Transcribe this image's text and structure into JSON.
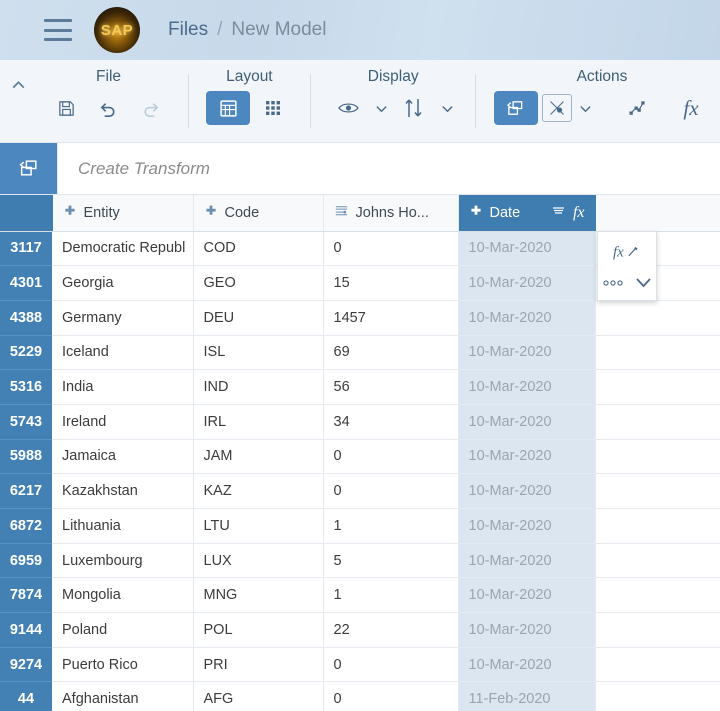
{
  "shellbar": {
    "menu_icon": "hamburger-menu-icon",
    "logo_text": "SAP",
    "breadcrumb": {
      "root": "Files",
      "separator": "/",
      "current": "New Model"
    }
  },
  "toolbar": {
    "collapse_icon": "chevron-up-icon",
    "groups": [
      {
        "title": "File",
        "items": [
          {
            "name": "save-button",
            "icon": "save-floppy-icon",
            "state": "enabled"
          },
          {
            "name": "undo-button",
            "icon": "undo-arrow-icon",
            "state": "enabled"
          },
          {
            "name": "redo-button",
            "icon": "redo-arrow-icon",
            "state": "disabled"
          }
        ]
      },
      {
        "title": "Layout",
        "items": [
          {
            "name": "grid-view-button",
            "icon": "table-grid-icon",
            "state": "selected"
          },
          {
            "name": "tile-view-button",
            "icon": "tiles-icon",
            "state": "enabled"
          }
        ]
      },
      {
        "title": "Display",
        "items": [
          {
            "name": "visibility-button",
            "icon": "eye-icon",
            "state": "enabled",
            "has_chevron": true
          },
          {
            "name": "sort-button",
            "icon": "sort-updown-arrows-icon",
            "state": "enabled",
            "has_chevron": true
          }
        ]
      },
      {
        "title": "Actions",
        "items": [
          {
            "name": "create-transform-button",
            "icon": "transform-icon",
            "state": "selected"
          },
          {
            "name": "filter-map-button",
            "icon": "geo-enrich-icon",
            "state": "outlined",
            "has_chevron": true
          },
          {
            "name": "smart-transform-button",
            "icon": "data-points-icon",
            "state": "enabled"
          },
          {
            "name": "formula-button",
            "icon": "fx-icon",
            "state": "enabled"
          }
        ]
      }
    ]
  },
  "formula_bar": {
    "icon": "transform-icon",
    "placeholder": "Create Transform",
    "value": ""
  },
  "grid": {
    "columns": [
      {
        "key": "rownum",
        "label": "",
        "icon": "",
        "selected": false
      },
      {
        "key": "entity",
        "label": "Entity",
        "icon": "dimension-icon",
        "selected": false
      },
      {
        "key": "code",
        "label": "Code",
        "icon": "dimension-icon",
        "selected": false
      },
      {
        "key": "measure",
        "label": "Johns Ho...",
        "icon": "measure-icon",
        "selected": false
      },
      {
        "key": "date",
        "label": "Date",
        "icon": "dimension-icon",
        "selected": true,
        "header_icons": [
          "menu-lines-icon",
          "fx-icon"
        ]
      },
      {
        "key": "blank",
        "label": "",
        "icon": "",
        "selected": false
      }
    ],
    "rows": [
      {
        "num": "3117",
        "entity": "Democratic Republ",
        "code": "COD",
        "measure": "0",
        "date": "10-Mar-2020"
      },
      {
        "num": "4301",
        "entity": "Georgia",
        "code": "GEO",
        "measure": "15",
        "date": "10-Mar-2020"
      },
      {
        "num": "4388",
        "entity": "Germany",
        "code": "DEU",
        "measure": "1457",
        "date": "10-Mar-2020"
      },
      {
        "num": "5229",
        "entity": "Iceland",
        "code": "ISL",
        "measure": "69",
        "date": "10-Mar-2020"
      },
      {
        "num": "5316",
        "entity": "India",
        "code": "IND",
        "measure": "56",
        "date": "10-Mar-2020"
      },
      {
        "num": "5743",
        "entity": "Ireland",
        "code": "IRL",
        "measure": "34",
        "date": "10-Mar-2020"
      },
      {
        "num": "5988",
        "entity": "Jamaica",
        "code": "JAM",
        "measure": "0",
        "date": "10-Mar-2020"
      },
      {
        "num": "6217",
        "entity": "Kazakhstan",
        "code": "KAZ",
        "measure": "0",
        "date": "10-Mar-2020"
      },
      {
        "num": "6872",
        "entity": "Lithuania",
        "code": "LTU",
        "measure": "1",
        "date": "10-Mar-2020"
      },
      {
        "num": "6959",
        "entity": "Luxembourg",
        "code": "LUX",
        "measure": "5",
        "date": "10-Mar-2020"
      },
      {
        "num": "7874",
        "entity": "Mongolia",
        "code": "MNG",
        "measure": "1",
        "date": "10-Mar-2020"
      },
      {
        "num": "9144",
        "entity": "Poland",
        "code": "POL",
        "measure": "22",
        "date": "10-Mar-2020"
      },
      {
        "num": "9274",
        "entity": "Puerto Rico",
        "code": "PRI",
        "measure": "0",
        "date": "10-Mar-2020"
      },
      {
        "num": "44",
        "entity": "Afghanistan",
        "code": "AFG",
        "measure": "0",
        "date": "11-Feb-2020"
      }
    ]
  },
  "popup": {
    "items": [
      {
        "name": "edit-formula-button",
        "icon": "fx-pencil-icon"
      },
      {
        "name": "more-options-button",
        "icon": "ellipsis-icon"
      },
      {
        "name": "expand-button",
        "icon": "chevron-down-icon"
      }
    ]
  },
  "colors": {
    "accent": "#4d87bf",
    "header_selected": "#3f7cb0",
    "rownum_bg": "#4380b4",
    "date_col_bg": "#dbe6f0",
    "toolbar_bg": "#f2f6fa"
  }
}
